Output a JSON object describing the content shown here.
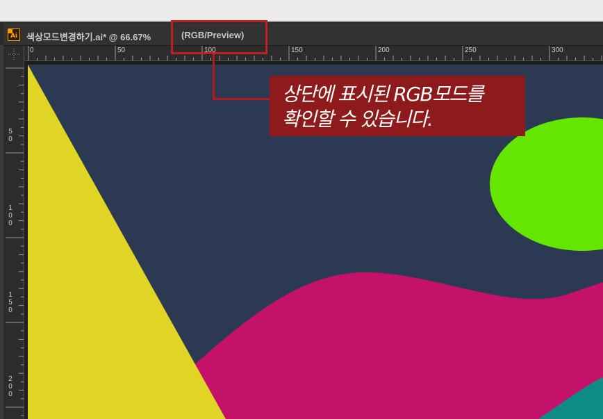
{
  "document_tab": {
    "app_icon": "illustrator-ai-icon",
    "app_icon_text": "Ai",
    "title": "색상모드변경하기.ai* @ 66.67%",
    "color_mode": "(RGB/Preview)"
  },
  "horizontal_ruler": {
    "labels": [
      "0",
      "50",
      "100",
      "150",
      "200",
      "250",
      "300"
    ]
  },
  "vertical_ruler": {
    "labels": [
      "5\n0",
      "1\n0\n0",
      "1\n5\n0",
      "2\n0\n0"
    ]
  },
  "artwork": {
    "background_color": "#2b3a52",
    "triangle_color": "#e0d424",
    "wave_color": "#c4116a",
    "ellipse_color": "#64e600",
    "teal_color": "#0e8a87"
  },
  "annotation": {
    "highlight_color": "#c21f24",
    "callout_bg": "#8e1a1b",
    "callout_line1": "상단에 표시된 RGB모드를",
    "callout_line2": "확인할 수 있습니다."
  }
}
